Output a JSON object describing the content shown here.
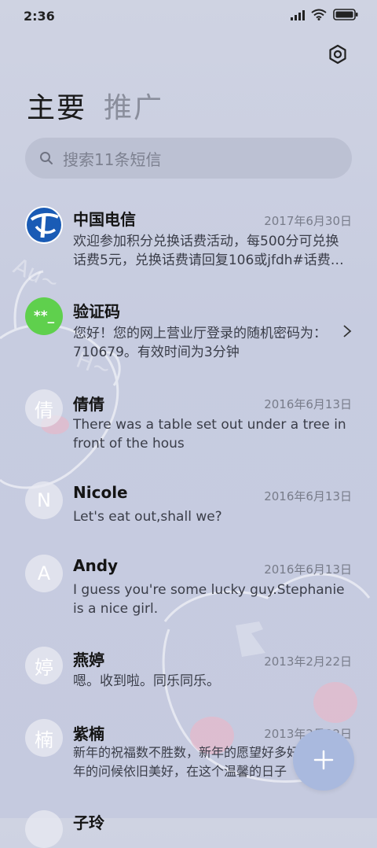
{
  "status_bar": {
    "time": "2:36"
  },
  "tabs": [
    {
      "label": "主要",
      "active": true
    },
    {
      "label": "推广",
      "active": false
    }
  ],
  "search": {
    "placeholder": "搜索11条短信"
  },
  "messages": [
    {
      "name": "中国电信",
      "date": "2017年6月30日",
      "preview": "欢迎参加积分兑换话费活动，每500分可兑换话费5元，兑换话费请回复106或jfdh#话费…",
      "avatar": "telecom-logo"
    },
    {
      "name": "验证码",
      "date": "",
      "preview": "您好！您的网上营业厅登录的随机密码为：710679。有效时间为3分钟",
      "avatar": "**_"
    },
    {
      "name": "倩倩",
      "date": "2016年6月13日",
      "preview": "There was a table set out under a tree in front of the hous",
      "avatar": "倩"
    },
    {
      "name": "Nicole",
      "date": "2016年6月13日",
      "preview": "Let's eat out,shall we?",
      "avatar": "N"
    },
    {
      "name": "Andy",
      "date": "2016年6月13日",
      "preview": "I guess you're some lucky guy.Stephanie is a nice girl.",
      "avatar": "A"
    },
    {
      "name": "燕婷",
      "date": "2013年2月22日",
      "preview": "嗯。收到啦。同乐同乐。",
      "avatar": "婷"
    },
    {
      "name": "紫楠",
      "date": "2013年2月22日",
      "preview": "新年的祝福数不胜数，新年的愿望好多好多，新年的问候依旧美好，在这个温馨的日子",
      "avatar": "楠"
    },
    {
      "name": "子玲",
      "date": "",
      "preview": "",
      "avatar": ""
    }
  ],
  "colors": {
    "background": "#c9cee0",
    "verify_avatar": "#5fd04d",
    "fab": "#a9b9de",
    "telecom_blue": "#1a5bb5"
  }
}
